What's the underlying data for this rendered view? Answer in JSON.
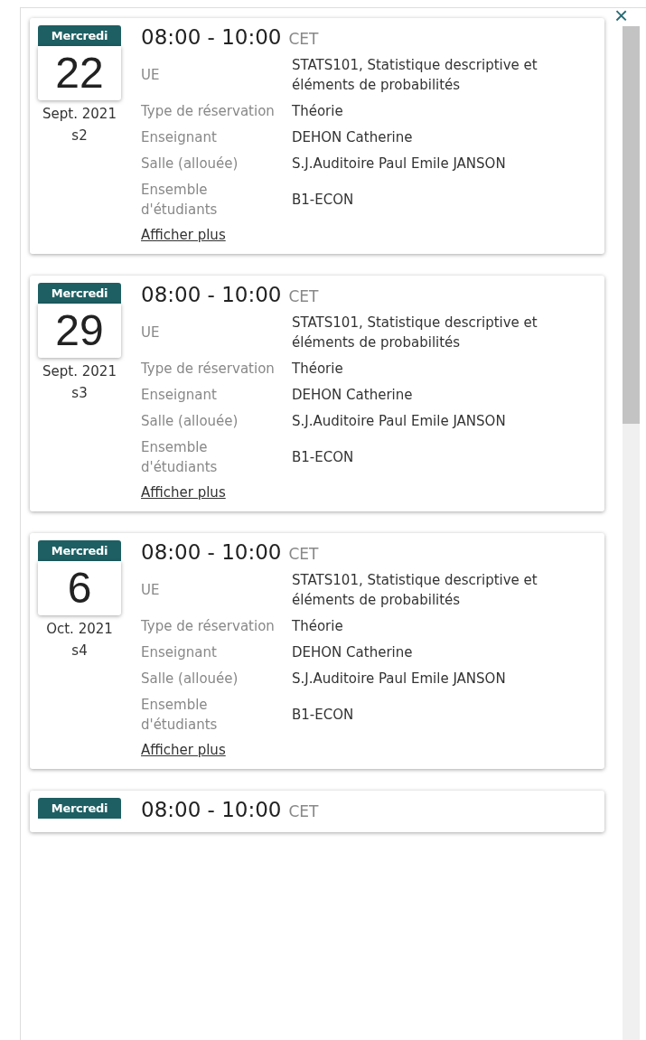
{
  "close_button": "×",
  "events": [
    {
      "weekday": "Mercredi",
      "day": "22",
      "month_year": "Sept. 2021",
      "week": "s2",
      "time": "08:00 - 10:00",
      "timezone": "CET",
      "fields": [
        {
          "label": "UE",
          "value": "STATS101, Statistique descriptive et éléments de probabilités"
        },
        {
          "label": "Type de réservation",
          "value": "Théorie"
        },
        {
          "label": "Enseignant",
          "value": "DEHON Catherine"
        },
        {
          "label": "Salle (allouée)",
          "value": "S.J.Auditoire Paul Emile JANSON"
        },
        {
          "label": "Ensemble d'étudiants",
          "value": "B1-ECON"
        }
      ],
      "more_link": "Afficher plus"
    },
    {
      "weekday": "Mercredi",
      "day": "29",
      "month_year": "Sept. 2021",
      "week": "s3",
      "time": "08:00 - 10:00",
      "timezone": "CET",
      "fields": [
        {
          "label": "UE",
          "value": "STATS101, Statistique descriptive et éléments de probabilités"
        },
        {
          "label": "Type de réservation",
          "value": "Théorie"
        },
        {
          "label": "Enseignant",
          "value": "DEHON Catherine"
        },
        {
          "label": "Salle (allouée)",
          "value": "S.J.Auditoire Paul Emile JANSON"
        },
        {
          "label": "Ensemble d'étudiants",
          "value": "B1-ECON"
        }
      ],
      "more_link": "Afficher plus"
    },
    {
      "weekday": "Mercredi",
      "day": "6",
      "month_year": "Oct. 2021",
      "week": "s4",
      "time": "08:00 - 10:00",
      "timezone": "CET",
      "fields": [
        {
          "label": "UE",
          "value": "STATS101, Statistique descriptive et éléments de probabilités"
        },
        {
          "label": "Type de réservation",
          "value": "Théorie"
        },
        {
          "label": "Enseignant",
          "value": "DEHON Catherine"
        },
        {
          "label": "Salle (allouée)",
          "value": "S.J.Auditoire Paul Emile JANSON"
        },
        {
          "label": "Ensemble d'étudiants",
          "value": "B1-ECON"
        }
      ],
      "more_link": "Afficher plus"
    },
    {
      "weekday": "Mercredi",
      "time": "08:00 - 10:00",
      "timezone": "CET"
    }
  ]
}
